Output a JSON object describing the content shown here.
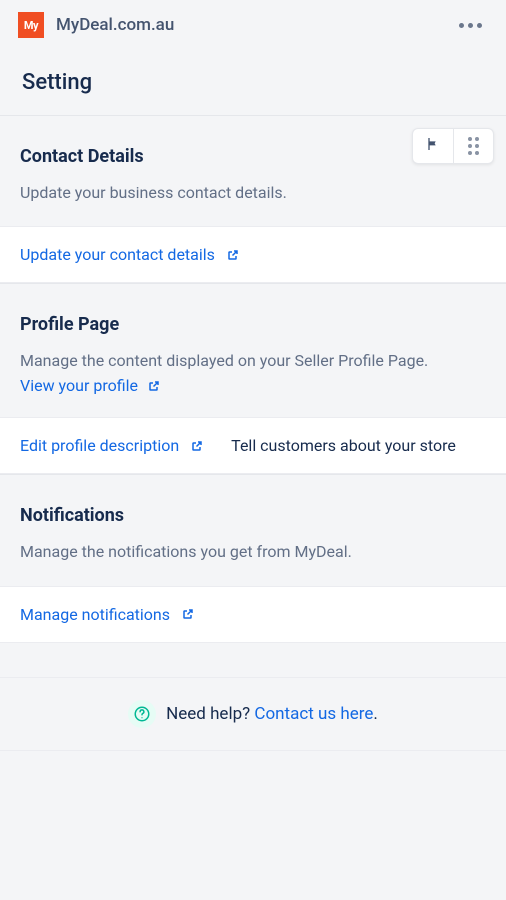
{
  "header": {
    "app_name": "MyDeal.com.au",
    "logo_text": "My"
  },
  "page": {
    "title": "Setting"
  },
  "sections": {
    "contact": {
      "title": "Contact Details",
      "description": "Update your business contact details.",
      "action": "Update your contact details"
    },
    "profile": {
      "title": "Profile Page",
      "description": "Manage the content displayed on your Seller Profile Page.",
      "inline_link": "View your profile",
      "action": "Edit profile description",
      "aside": "Tell customers about your store"
    },
    "notifications": {
      "title": "Notifications",
      "description": "Manage the notifications you get from MyDeal.",
      "action": "Manage notifications"
    }
  },
  "help": {
    "prefix": "Need help? ",
    "link": "Contact us here",
    "suffix": "."
  }
}
